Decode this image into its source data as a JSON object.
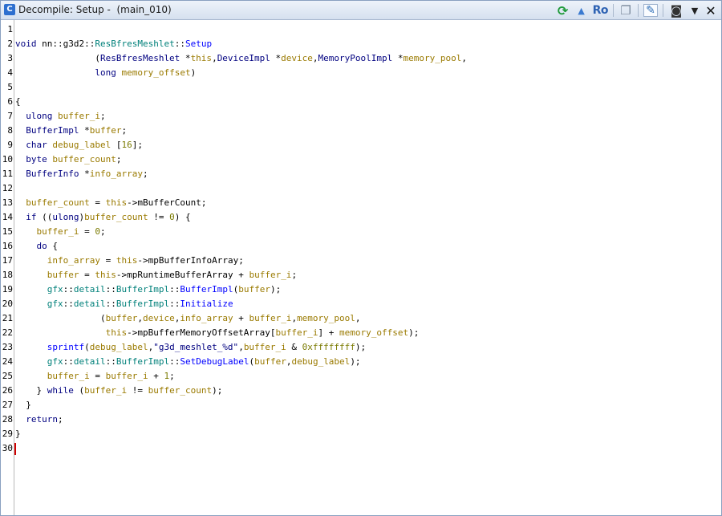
{
  "window": {
    "title": "Decompile: Setup -  (main_010)",
    "app_icon": "C",
    "toolbar": {
      "refresh_icon": "refresh-icon",
      "tree_icon": "function-graph-icon",
      "ro_label": "Ro",
      "copy_icon": "copy-icon",
      "edit_icon": "edit-icon",
      "snapshot_icon": "snapshot-icon",
      "menu_icon": "▼",
      "close_icon": "✕"
    }
  },
  "lines": [
    {
      "n": "1",
      "tokens": []
    },
    {
      "n": "2",
      "tokens": [
        [
          "kw",
          "void"
        ],
        [
          "pl",
          " nn::g3d2::"
        ],
        [
          "ns",
          "ResBfresMeshlet"
        ],
        [
          "pl",
          "::"
        ],
        [
          "fn",
          "Setup"
        ]
      ]
    },
    {
      "n": "3",
      "tokens": [
        [
          "pl",
          "               ("
        ],
        [
          "ty",
          "ResBfresMeshlet"
        ],
        [
          "pl",
          " *"
        ],
        [
          "vr",
          "this"
        ],
        [
          "pl",
          ","
        ],
        [
          "ty",
          "DeviceImpl"
        ],
        [
          "pl",
          " *"
        ],
        [
          "vr",
          "device"
        ],
        [
          "pl",
          ","
        ],
        [
          "ty",
          "MemoryPoolImpl"
        ],
        [
          "pl",
          " *"
        ],
        [
          "vr",
          "memory_pool"
        ],
        [
          "pl",
          ","
        ]
      ]
    },
    {
      "n": "4",
      "tokens": [
        [
          "pl",
          "               "
        ],
        [
          "ty",
          "long"
        ],
        [
          "pl",
          " "
        ],
        [
          "vr",
          "memory_offset"
        ],
        [
          "pl",
          ")"
        ]
      ]
    },
    {
      "n": "5",
      "tokens": []
    },
    {
      "n": "6",
      "tokens": [
        [
          "pl",
          "{"
        ]
      ]
    },
    {
      "n": "7",
      "tokens": [
        [
          "pl",
          "  "
        ],
        [
          "ty",
          "ulong"
        ],
        [
          "pl",
          " "
        ],
        [
          "vr",
          "buffer_i"
        ],
        [
          "pl",
          ";"
        ]
      ]
    },
    {
      "n": "8",
      "tokens": [
        [
          "pl",
          "  "
        ],
        [
          "ty",
          "BufferImpl"
        ],
        [
          "pl",
          " *"
        ],
        [
          "vr",
          "buffer"
        ],
        [
          "pl",
          ";"
        ]
      ]
    },
    {
      "n": "9",
      "tokens": [
        [
          "pl",
          "  "
        ],
        [
          "ty",
          "char"
        ],
        [
          "pl",
          " "
        ],
        [
          "vr",
          "debug_label"
        ],
        [
          "pl",
          " ["
        ],
        [
          "nm",
          "16"
        ],
        [
          "pl",
          "];"
        ]
      ]
    },
    {
      "n": "10",
      "tokens": [
        [
          "pl",
          "  "
        ],
        [
          "ty",
          "byte"
        ],
        [
          "pl",
          " "
        ],
        [
          "vr",
          "buffer_count"
        ],
        [
          "pl",
          ";"
        ]
      ]
    },
    {
      "n": "11",
      "tokens": [
        [
          "pl",
          "  "
        ],
        [
          "ty",
          "BufferInfo"
        ],
        [
          "pl",
          " *"
        ],
        [
          "vr",
          "info_array"
        ],
        [
          "pl",
          ";"
        ]
      ]
    },
    {
      "n": "12",
      "tokens": []
    },
    {
      "n": "13",
      "tokens": [
        [
          "pl",
          "  "
        ],
        [
          "vr",
          "buffer_count"
        ],
        [
          "pl",
          " = "
        ],
        [
          "vr",
          "this"
        ],
        [
          "pl",
          "->"
        ],
        [
          "pl",
          "mBufferCount;"
        ]
      ]
    },
    {
      "n": "14",
      "tokens": [
        [
          "pl",
          "  "
        ],
        [
          "kw",
          "if"
        ],
        [
          "pl",
          " (("
        ],
        [
          "ty",
          "ulong"
        ],
        [
          "pl",
          ")"
        ],
        [
          "vr",
          "buffer_count"
        ],
        [
          "pl",
          " != "
        ],
        [
          "nm",
          "0"
        ],
        [
          "pl",
          ") {"
        ]
      ]
    },
    {
      "n": "15",
      "tokens": [
        [
          "pl",
          "    "
        ],
        [
          "vr",
          "buffer_i"
        ],
        [
          "pl",
          " = "
        ],
        [
          "nm",
          "0"
        ],
        [
          "pl",
          ";"
        ]
      ]
    },
    {
      "n": "16",
      "tokens": [
        [
          "pl",
          "    "
        ],
        [
          "kw",
          "do"
        ],
        [
          "pl",
          " {"
        ]
      ]
    },
    {
      "n": "17",
      "tokens": [
        [
          "pl",
          "      "
        ],
        [
          "vr",
          "info_array"
        ],
        [
          "pl",
          " = "
        ],
        [
          "vr",
          "this"
        ],
        [
          "pl",
          "->mpBufferInfoArray;"
        ]
      ]
    },
    {
      "n": "18",
      "tokens": [
        [
          "pl",
          "      "
        ],
        [
          "vr",
          "buffer"
        ],
        [
          "pl",
          " = "
        ],
        [
          "vr",
          "this"
        ],
        [
          "pl",
          "->mpRuntimeBufferArray + "
        ],
        [
          "vr",
          "buffer_i"
        ],
        [
          "pl",
          ";"
        ]
      ]
    },
    {
      "n": "19",
      "tokens": [
        [
          "pl",
          "      "
        ],
        [
          "ns",
          "gfx"
        ],
        [
          "pl",
          "::"
        ],
        [
          "ns",
          "detail"
        ],
        [
          "pl",
          "::"
        ],
        [
          "ns",
          "BufferImpl"
        ],
        [
          "pl",
          "::"
        ],
        [
          "fn",
          "BufferImpl"
        ],
        [
          "pl",
          "("
        ],
        [
          "vr",
          "buffer"
        ],
        [
          "pl",
          ");"
        ]
      ]
    },
    {
      "n": "20",
      "tokens": [
        [
          "pl",
          "      "
        ],
        [
          "ns",
          "gfx"
        ],
        [
          "pl",
          "::"
        ],
        [
          "ns",
          "detail"
        ],
        [
          "pl",
          "::"
        ],
        [
          "ns",
          "BufferImpl"
        ],
        [
          "pl",
          "::"
        ],
        [
          "fn",
          "Initialize"
        ]
      ]
    },
    {
      "n": "21",
      "tokens": [
        [
          "pl",
          "                ("
        ],
        [
          "vr",
          "buffer"
        ],
        [
          "pl",
          ","
        ],
        [
          "vr",
          "device"
        ],
        [
          "pl",
          ","
        ],
        [
          "vr",
          "info_array"
        ],
        [
          "pl",
          " + "
        ],
        [
          "vr",
          "buffer_i"
        ],
        [
          "pl",
          ","
        ],
        [
          "vr",
          "memory_pool"
        ],
        [
          "pl",
          ","
        ]
      ]
    },
    {
      "n": "22",
      "tokens": [
        [
          "pl",
          "                 "
        ],
        [
          "vr",
          "this"
        ],
        [
          "pl",
          "->mpBufferMemoryOffsetArray["
        ],
        [
          "vr",
          "buffer_i"
        ],
        [
          "pl",
          "] + "
        ],
        [
          "vr",
          "memory_offset"
        ],
        [
          "pl",
          ");"
        ]
      ]
    },
    {
      "n": "23",
      "tokens": [
        [
          "pl",
          "      "
        ],
        [
          "fn",
          "sprintf"
        ],
        [
          "pl",
          "("
        ],
        [
          "vr",
          "debug_label"
        ],
        [
          "pl",
          ","
        ],
        [
          "st",
          "\"g3d_meshlet_%d\""
        ],
        [
          "pl",
          ","
        ],
        [
          "vr",
          "buffer_i"
        ],
        [
          "pl",
          " & "
        ],
        [
          "nm",
          "0xffffffff"
        ],
        [
          "pl",
          ");"
        ]
      ]
    },
    {
      "n": "24",
      "tokens": [
        [
          "pl",
          "      "
        ],
        [
          "ns",
          "gfx"
        ],
        [
          "pl",
          "::"
        ],
        [
          "ns",
          "detail"
        ],
        [
          "pl",
          "::"
        ],
        [
          "ns",
          "BufferImpl"
        ],
        [
          "pl",
          "::"
        ],
        [
          "fn",
          "SetDebugLabel"
        ],
        [
          "pl",
          "("
        ],
        [
          "vr",
          "buffer"
        ],
        [
          "pl",
          ","
        ],
        [
          "vr",
          "debug_label"
        ],
        [
          "pl",
          ");"
        ]
      ]
    },
    {
      "n": "25",
      "tokens": [
        [
          "pl",
          "      "
        ],
        [
          "vr",
          "buffer_i"
        ],
        [
          "pl",
          " = "
        ],
        [
          "vr",
          "buffer_i"
        ],
        [
          "pl",
          " + "
        ],
        [
          "nm",
          "1"
        ],
        [
          "pl",
          ";"
        ]
      ]
    },
    {
      "n": "26",
      "tokens": [
        [
          "pl",
          "    } "
        ],
        [
          "kw",
          "while"
        ],
        [
          "pl",
          " ("
        ],
        [
          "vr",
          "buffer_i"
        ],
        [
          "pl",
          " != "
        ],
        [
          "vr",
          "buffer_count"
        ],
        [
          "pl",
          ");"
        ]
      ]
    },
    {
      "n": "27",
      "tokens": [
        [
          "pl",
          "  }"
        ]
      ]
    },
    {
      "n": "28",
      "tokens": [
        [
          "pl",
          "  "
        ],
        [
          "kw",
          "return"
        ],
        [
          "pl",
          ";"
        ]
      ]
    },
    {
      "n": "29",
      "tokens": [
        [
          "pl",
          "}"
        ]
      ]
    },
    {
      "n": "30",
      "tokens": []
    }
  ]
}
